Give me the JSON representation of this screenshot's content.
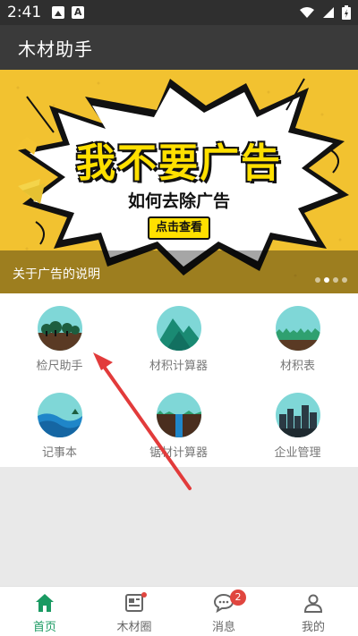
{
  "status_bar": {
    "time": "2:41",
    "left_icons": [
      "image-icon",
      "font-icon"
    ],
    "right_icons": [
      "wifi-icon",
      "signal-icon",
      "battery-icon"
    ]
  },
  "app_bar": {
    "title": "木材助手"
  },
  "banner": {
    "headline": "我不要广告",
    "subtitle": "如何去除广告",
    "cta": "点击查看",
    "caption": "关于广告的说明",
    "dots_count": 4,
    "active_dot": 1
  },
  "grid": {
    "items": [
      {
        "label": "检尺助手",
        "icon": "forest-scene-icon"
      },
      {
        "label": "材积计算器",
        "icon": "mountain-icon"
      },
      {
        "label": "材积表",
        "icon": "grass-scene-icon"
      },
      {
        "label": "记事本",
        "icon": "wave-icon"
      },
      {
        "label": "锯材计算器",
        "icon": "waterfall-icon"
      },
      {
        "label": "企业管理",
        "icon": "city-skyline-icon"
      }
    ]
  },
  "tabs": [
    {
      "label": "首页",
      "icon": "home-icon",
      "active": true
    },
    {
      "label": "木材圈",
      "icon": "news-icon",
      "dot": true
    },
    {
      "label": "消息",
      "icon": "chat-icon",
      "badge": "2"
    },
    {
      "label": "我的",
      "icon": "user-icon"
    }
  ],
  "colors": {
    "status_bar": "#2f2f2f",
    "app_bar": "#3a3a3a",
    "banner_bg": "#f2c230",
    "accent": "#1a9a62",
    "badge": "#e0463f",
    "arrow": "#e23b3b"
  }
}
